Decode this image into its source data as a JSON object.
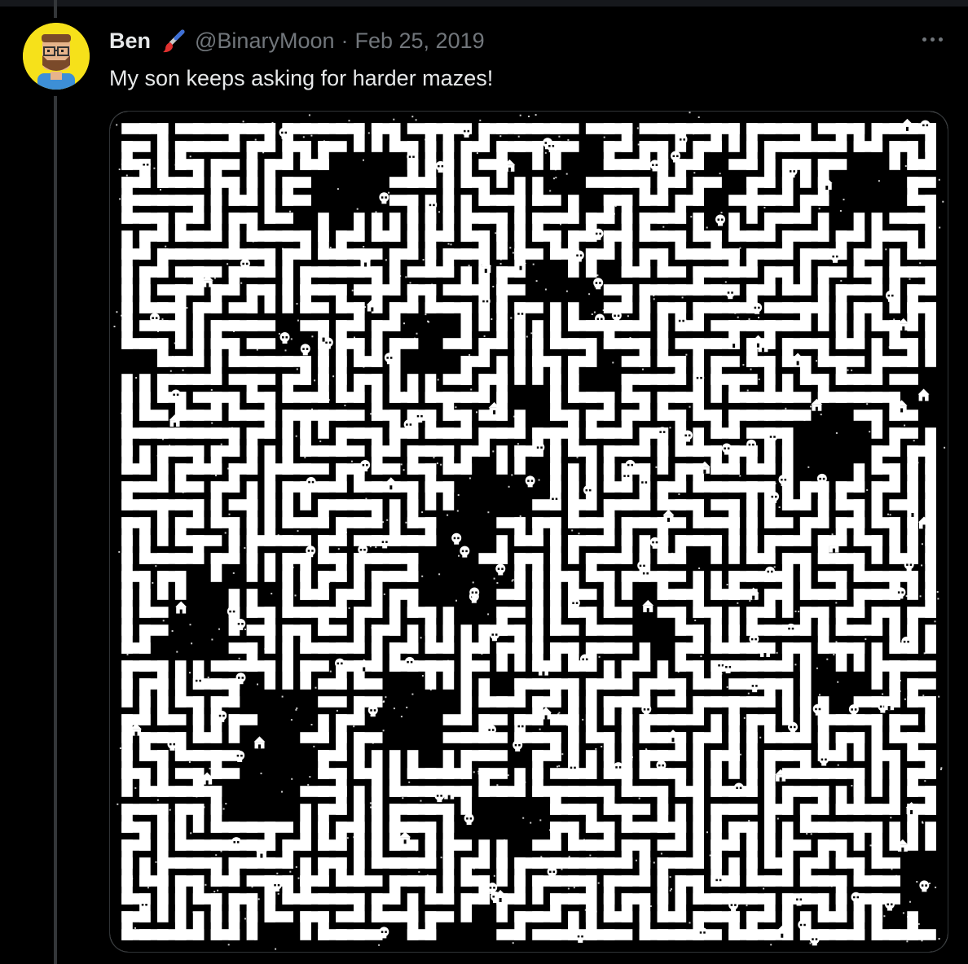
{
  "tweet": {
    "author_name": "Ben",
    "author_emoji_icon": "paintbrush-icon",
    "handle": "@BinaryMoon",
    "separator": "·",
    "date": "Feb 25, 2019",
    "text": "My son keeps asking for harder mazes!",
    "more_icon": "more-horizontal-icon"
  },
  "media": {
    "kind": "maze-image",
    "content_description": "Large black and white pixel maze with skull and house icons",
    "icons": [
      "skull-icon",
      "house-icon"
    ]
  },
  "colors": {
    "background": "#000000",
    "text_primary": "#e7e9ea",
    "text_secondary": "#71767b",
    "avatar_bg": "#f6e11a"
  }
}
